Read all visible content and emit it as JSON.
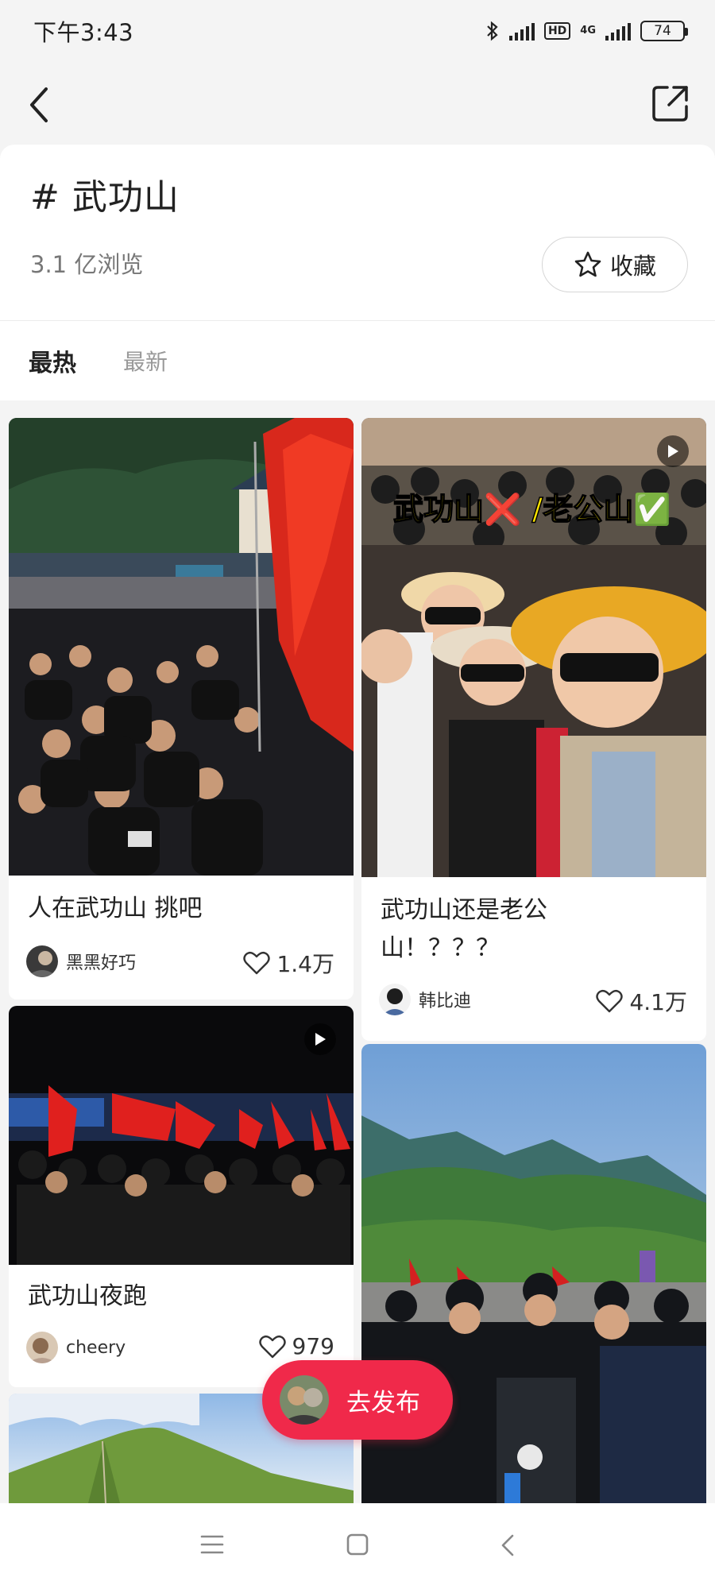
{
  "status_bar": {
    "time": "下午3:43",
    "network": "4G",
    "hd": "HD",
    "battery": "74"
  },
  "nav": {
    "back_icon": "chevron-left-icon",
    "share_icon": "share-external-icon"
  },
  "topic": {
    "title": "# 武功山",
    "views": "3.1 亿浏览",
    "favorite_label": "收藏"
  },
  "tabs": [
    {
      "label": "最热",
      "active": true
    },
    {
      "label": "最新",
      "active": false
    }
  ],
  "cards": [
    {
      "title": "人在武功山 挑吧",
      "author": "黑黑好巧",
      "likes": "1.4万",
      "video": false
    },
    {
      "title": "武功山还是老公山！？？？",
      "overlay": "武功山❌ /老公山✅",
      "author": "韩比迪",
      "likes": "4.1万",
      "video": true
    },
    {
      "title": "武功山夜跑",
      "author": "cheery",
      "likes": "979",
      "video": true
    },
    {
      "title": "",
      "author": "",
      "likes": "",
      "video": false
    },
    {
      "title": "",
      "author": "",
      "likes": "",
      "video": false
    }
  ],
  "publish": {
    "label": "去发布"
  },
  "colors": {
    "accent": "#f0294a",
    "background": "#f4f4f4",
    "card": "#ffffff"
  }
}
